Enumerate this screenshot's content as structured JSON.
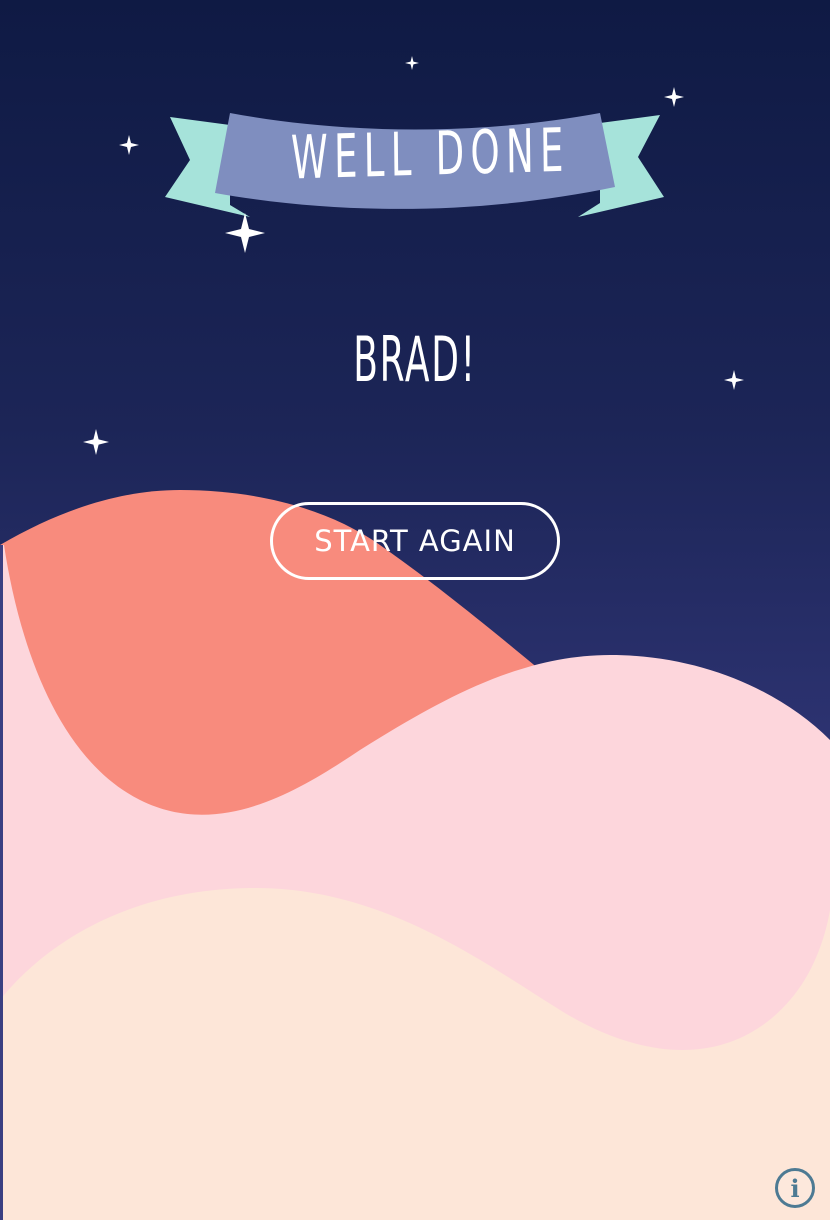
{
  "banner": {
    "title": "WELL DONE"
  },
  "greeting": {
    "name": "BRAD!"
  },
  "actions": {
    "start_again_label": "START AGAIN"
  },
  "info_button": {
    "icon": "info-icon",
    "glyph": "i"
  },
  "colors": {
    "sky_top": "#0f1a44",
    "sky_bottom": "#3a3f82",
    "banner_ribbon": "#7f8ebf",
    "banner_tails": "#a6e3da",
    "coral_hill": "#f88b7d",
    "pink_hill": "#fdd6dc",
    "cream_hill": "#fde6d8",
    "info_icon": "#4d7a93",
    "text": "#ffffff"
  }
}
